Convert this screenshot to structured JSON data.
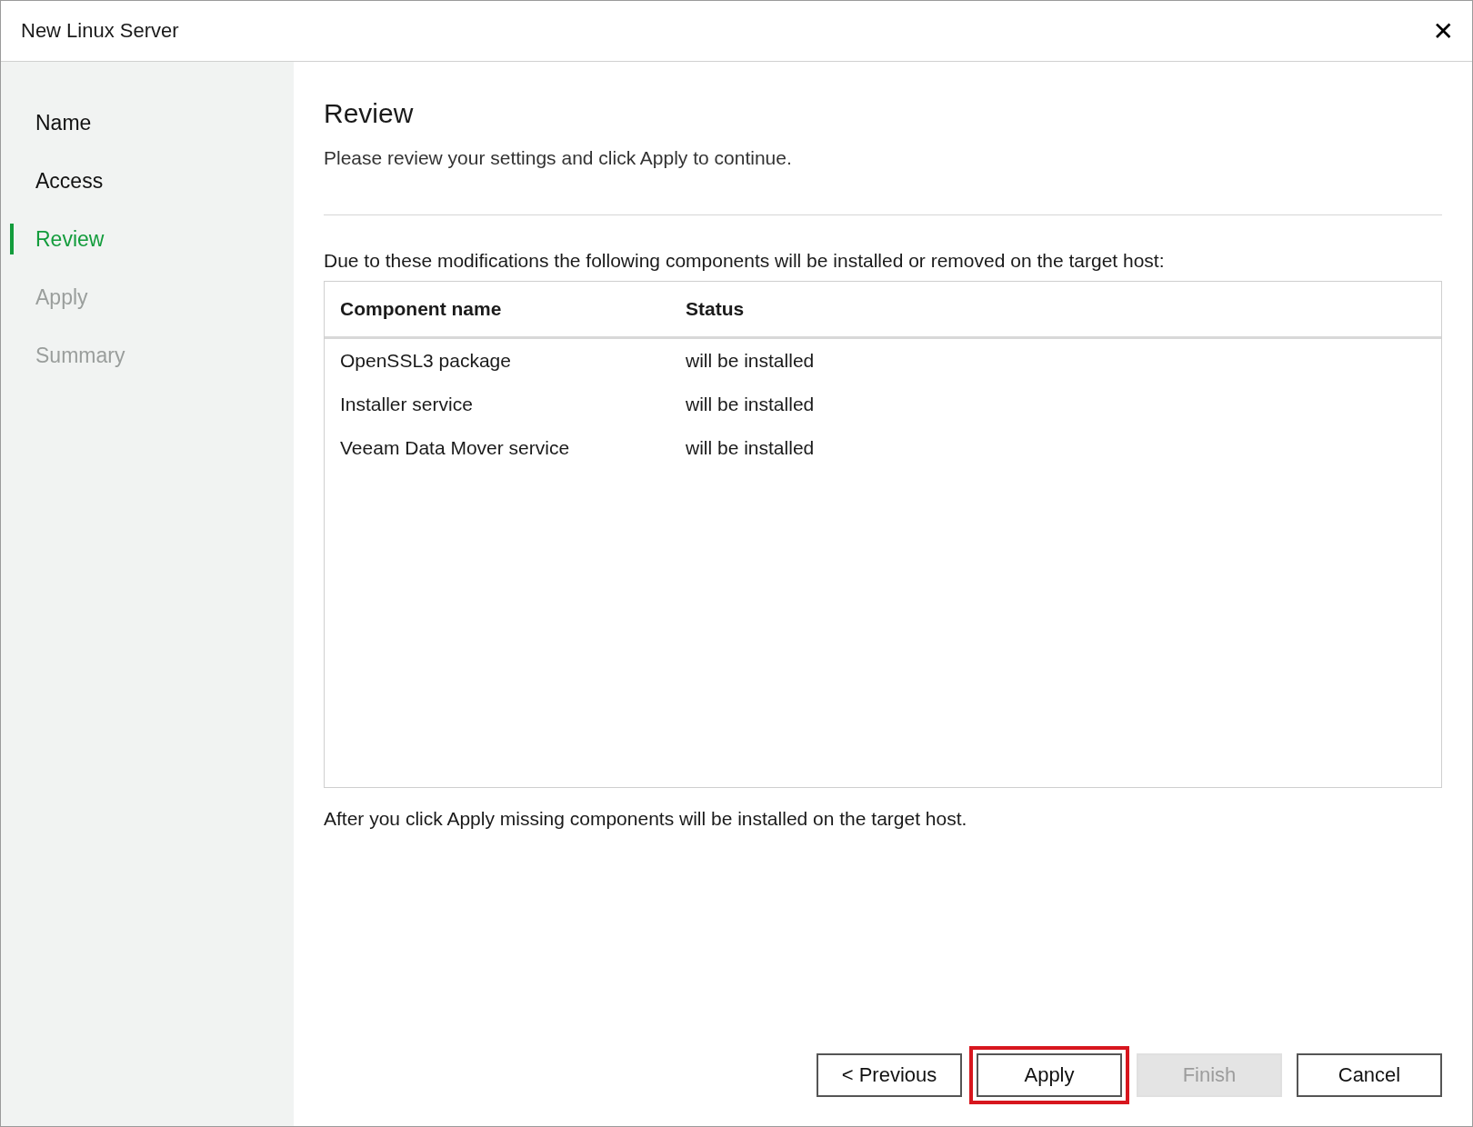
{
  "window": {
    "title": "New Linux Server",
    "close_label": "✕"
  },
  "steps": [
    {
      "label": "Name",
      "selected": false,
      "disabled": false
    },
    {
      "label": "Access",
      "selected": false,
      "disabled": false
    },
    {
      "label": "Review",
      "selected": true,
      "disabled": false
    },
    {
      "label": "Apply",
      "selected": false,
      "disabled": true
    },
    {
      "label": "Summary",
      "selected": false,
      "disabled": true
    }
  ],
  "page": {
    "title": "Review",
    "description": "Please review your settings and click Apply to continue.",
    "intro": "Due to these modifications the following components will be installed or removed on the target host:",
    "note": "After you click Apply missing components will be installed on the target host."
  },
  "table": {
    "columns": [
      "Component name",
      "Status"
    ],
    "rows": [
      [
        "OpenSSL3 package",
        "will be installed"
      ],
      [
        "Installer service",
        "will be installed"
      ],
      [
        "Veeam Data Mover service",
        "will be installed"
      ]
    ]
  },
  "buttons": [
    {
      "label": "< Previous",
      "disabled": false,
      "highlighted": false
    },
    {
      "label": "Apply",
      "disabled": false,
      "highlighted": true
    },
    {
      "label": "Finish",
      "disabled": true,
      "highlighted": false
    },
    {
      "label": "Cancel",
      "disabled": false,
      "highlighted": false
    }
  ]
}
